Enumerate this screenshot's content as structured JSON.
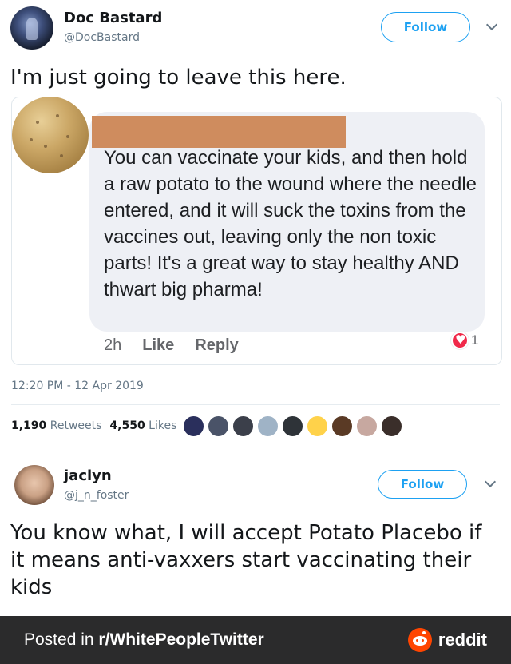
{
  "tweet": {
    "author_name": "Doc Bastard",
    "author_handle": "@DocBastard",
    "follow_label": "Follow",
    "text": "I'm just going to leave this here.",
    "timestamp": "12:20 PM - 12 Apr 2019",
    "retweets_count": "1,190",
    "retweets_label": "Retweets",
    "likes_count": "4,550",
    "likes_label": "Likes"
  },
  "embedded_comment": {
    "text": "You can vaccinate your kids, and then hold a raw potato to the wound where the needle entered, and it will suck the toxins from the vaccines out, leaving only the non toxic parts! It's a great way to stay healthy AND thwart big pharma!",
    "age": "2h",
    "like_label": "Like",
    "reply_label": "Reply",
    "reaction_count": "1",
    "redaction_color": "#cf8c5e"
  },
  "liker_avatars": [
    "#2a2f5c",
    "#4a5368",
    "#3b3f4a",
    "#9fb3c6",
    "#2e3338",
    "#ffd24a",
    "#5a3a25",
    "#c7a8a0",
    "#3a2e2a"
  ],
  "reply": {
    "author_name": "jaclyn",
    "author_handle": "@j_n_foster",
    "follow_label": "Follow",
    "text": "You know what, I will accept Potato Placebo if it means anti-vaxxers start vaccinating their kids"
  },
  "footer": {
    "posted_in": "Posted in ",
    "subreddit": "r/WhitePeopleTwitter",
    "brand": "reddit",
    "brand_color": "#ff4500"
  }
}
